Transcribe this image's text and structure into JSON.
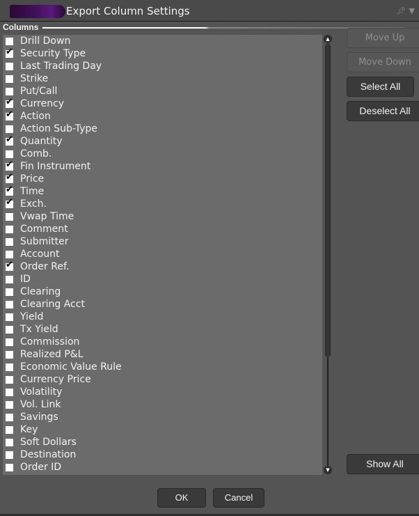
{
  "window": {
    "title": "Export Column Settings",
    "pin_icon": "pin-icon",
    "menu_icon": "chevron-down-icon"
  },
  "columns_label": "Columns",
  "columns": [
    {
      "label": "Drill Down",
      "checked": false
    },
    {
      "label": "Security Type",
      "checked": true
    },
    {
      "label": "Last Trading Day",
      "checked": false
    },
    {
      "label": "Strike",
      "checked": false
    },
    {
      "label": "Put/Call",
      "checked": false
    },
    {
      "label": "Currency",
      "checked": true
    },
    {
      "label": "Action",
      "checked": true
    },
    {
      "label": "Action Sub-Type",
      "checked": false
    },
    {
      "label": "Quantity",
      "checked": true
    },
    {
      "label": "Comb.",
      "checked": false
    },
    {
      "label": "Fin Instrument",
      "checked": true
    },
    {
      "label": "Price",
      "checked": true
    },
    {
      "label": "Time",
      "checked": true
    },
    {
      "label": "Exch.",
      "checked": true
    },
    {
      "label": "Vwap Time",
      "checked": false
    },
    {
      "label": "Comment",
      "checked": false
    },
    {
      "label": "Submitter",
      "checked": false
    },
    {
      "label": "Account",
      "checked": false
    },
    {
      "label": "Order Ref.",
      "checked": true
    },
    {
      "label": "ID",
      "checked": false
    },
    {
      "label": "Clearing",
      "checked": false
    },
    {
      "label": "Clearing Acct",
      "checked": false
    },
    {
      "label": "Yield",
      "checked": false
    },
    {
      "label": "Tx Yield",
      "checked": false
    },
    {
      "label": "Commission",
      "checked": false
    },
    {
      "label": "Realized P&L",
      "checked": false
    },
    {
      "label": "Economic Value Rule",
      "checked": false
    },
    {
      "label": "Currency Price",
      "checked": false
    },
    {
      "label": "Volatility",
      "checked": false
    },
    {
      "label": "Vol. Link",
      "checked": false
    },
    {
      "label": "Savings",
      "checked": false
    },
    {
      "label": "Key",
      "checked": false
    },
    {
      "label": "Soft Dollars",
      "checked": false
    },
    {
      "label": "Destination",
      "checked": false
    },
    {
      "label": "Order ID",
      "checked": false
    }
  ],
  "buttons": {
    "move_up": "Move Up",
    "move_down": "Move Down",
    "select_all": "Select All",
    "deselect_all": "Deselect All",
    "show_all": "Show All",
    "ok": "OK",
    "cancel": "Cancel"
  },
  "colors": {
    "dialog_bg": "#545454",
    "list_bg": "#6b6b6b",
    "button_bg": "#3a3a3a",
    "disabled_text": "#8e8e8e"
  }
}
